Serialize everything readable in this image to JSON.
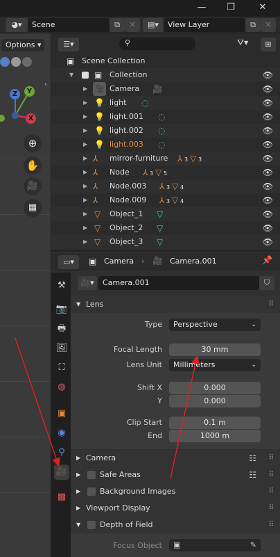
{
  "window": {
    "minimize": "—",
    "restore": "❐",
    "close": "✕"
  },
  "scene_bar": {
    "scene_label": "Scene",
    "view_layer_label": "View Layer"
  },
  "viewport": {
    "options_label": "Options",
    "axis_z": "Z",
    "axis_y": "Y",
    "axis_x": "X"
  },
  "outliner": {
    "search_placeholder": "",
    "rows": [
      {
        "label": "Scene Collection"
      },
      {
        "label": "Collection"
      },
      {
        "label": "Camera"
      },
      {
        "label": "light"
      },
      {
        "label": "light.001"
      },
      {
        "label": "light.002"
      },
      {
        "label": "light.003"
      },
      {
        "label": "mirror-furniture",
        "badge1": "3",
        "badge2": "3"
      },
      {
        "label": "Node",
        "badge1": "3",
        "badge2": "5"
      },
      {
        "label": "Node.003",
        "badge1": "3",
        "badge2": "4"
      },
      {
        "label": "Node.009",
        "badge1": "3",
        "badge2": "4"
      },
      {
        "label": "Object_1"
      },
      {
        "label": "Object_2"
      },
      {
        "label": "Object_3"
      }
    ]
  },
  "properties": {
    "breadcrumb_object": "Camera",
    "breadcrumb_data": "Camera.001",
    "datablock_name": "Camera.001",
    "lens_panel": {
      "title": "Lens",
      "type_label": "Type",
      "type_value": "Perspective",
      "focal_length_label": "Focal Length",
      "focal_length_value": "30 mm",
      "lens_unit_label": "Lens Unit",
      "lens_unit_value": "Millimeters",
      "shift_x_label": "Shift X",
      "shift_x_value": "0.000",
      "shift_y_label": "Y",
      "shift_y_value": "0.000",
      "clip_start_label": "Clip Start",
      "clip_start_value": "0.1 m",
      "clip_end_label": "End",
      "clip_end_value": "1000 m"
    },
    "collapsed_panels": {
      "camera": "Camera",
      "safe_areas": "Safe Areas",
      "background_images": "Background Images",
      "viewport_display": "Viewport Display",
      "depth_of_field": "Depth of Field"
    },
    "dof": {
      "focus_object_label": "Focus Object"
    }
  },
  "colors": {
    "accent_orange": "#e6893d",
    "accent_green": "#45c9a7",
    "annotation_red": "#e02020"
  }
}
